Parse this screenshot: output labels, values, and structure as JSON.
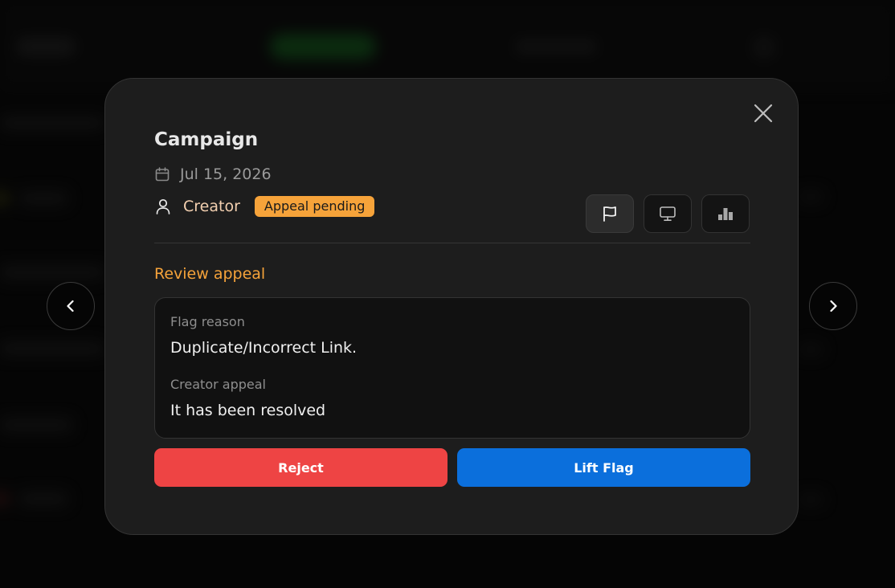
{
  "modal": {
    "title": "Campaign",
    "date": "Jul 15, 2026",
    "creator_label": "Creator",
    "status_badge": "Appeal pending",
    "section_title": "Review appeal",
    "flag_reason_label": "Flag reason",
    "flag_reason_value": "Duplicate/Incorrect Link.",
    "creator_appeal_label": "Creator appeal",
    "creator_appeal_value": "It has been resolved",
    "reject_label": "Reject",
    "lift_label": "Lift Flag"
  },
  "icons": {
    "close": "close-icon",
    "calendar": "calendar-icon",
    "user": "user-icon",
    "flag": "flag-icon",
    "monitor": "monitor-icon",
    "stats": "bar-chart-icon",
    "prev": "chevron-left-icon",
    "next": "chevron-right-icon"
  },
  "colors": {
    "accent_orange": "#f6a33a",
    "reject_red": "#ee4444",
    "lift_blue": "#0b6fdc",
    "modal_bg": "#1d1d1d"
  }
}
